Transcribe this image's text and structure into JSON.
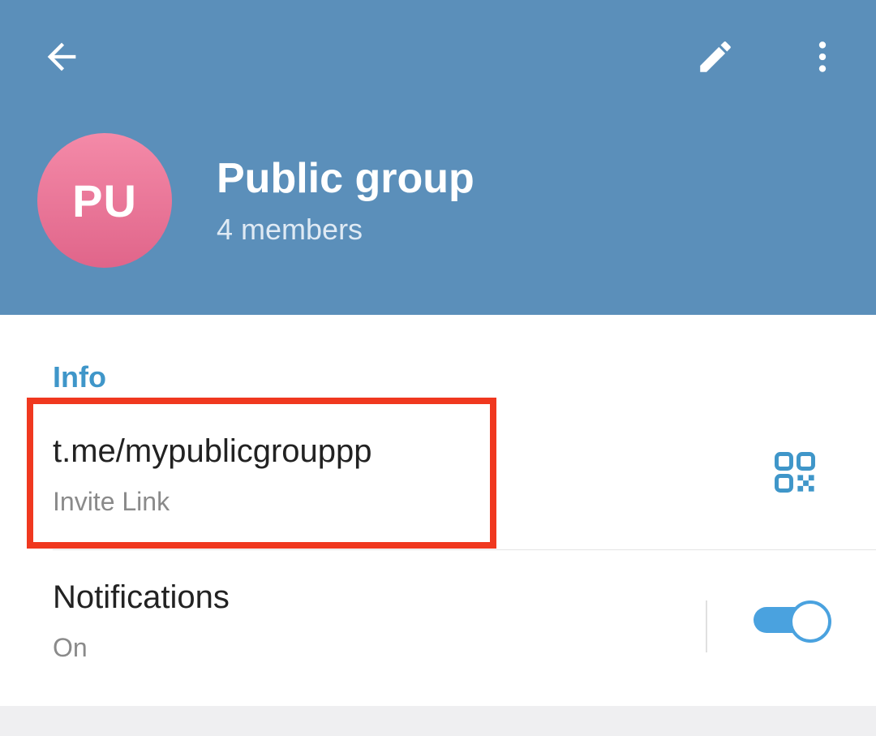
{
  "colors": {
    "header_bg": "#5b8fba",
    "accent": "#3f96c9",
    "toggle_on": "#4aa2df",
    "highlight": "#f0381f",
    "avatar_top": "#f48aa8",
    "avatar_bottom": "#e0658a"
  },
  "icons": {
    "back": "arrow-left",
    "edit": "pencil",
    "more": "vertical-dots",
    "qr": "qr-code"
  },
  "header": {
    "avatar_initials": "PU",
    "title": "Public group",
    "subtitle": "4 members"
  },
  "info": {
    "section_title": "Info",
    "link": {
      "value": "t.me/mypublicgrouppp",
      "caption": "Invite Link",
      "highlighted": true
    },
    "notifications": {
      "title": "Notifications",
      "status": "On",
      "enabled": true
    }
  }
}
